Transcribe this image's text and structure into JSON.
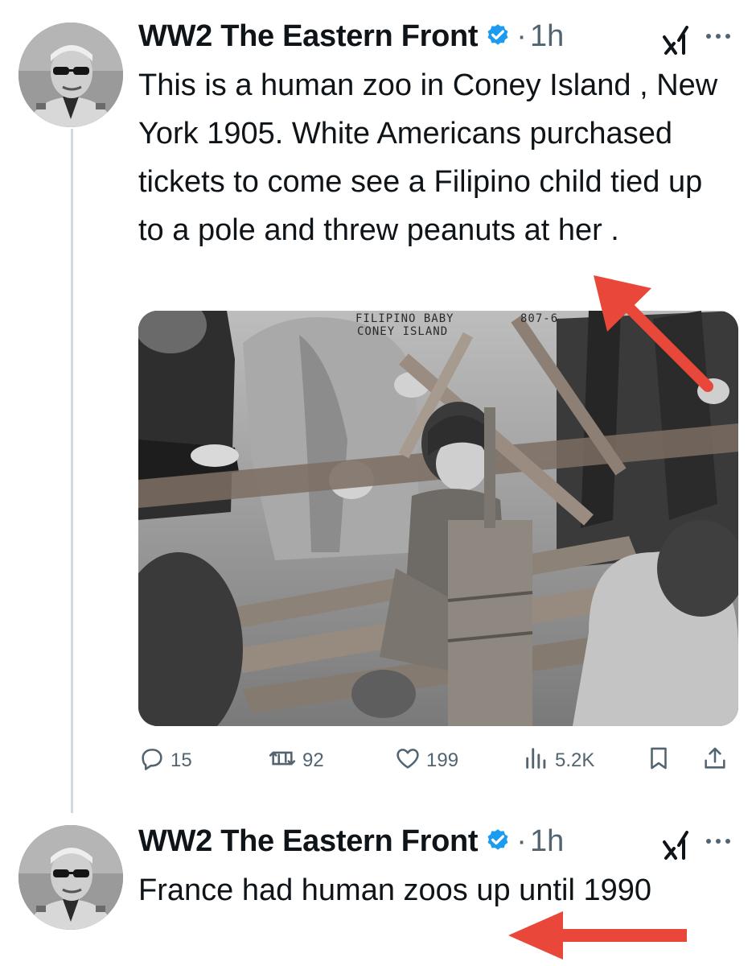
{
  "tweets": [
    {
      "author_name": "WW2 The Eastern Front",
      "verified": true,
      "separator": "·",
      "time": "1h",
      "text": "This is a human zoo in Coney Island , New York 1905. White Americans purchased tickets to come see a Filipino child tied up to a pole and threw peanuts at her .",
      "media": {
        "caption_line1": "FILIPINO  BABY",
        "caption_line2": "CONEY ISLAND",
        "caption_code": "807-6"
      },
      "stats": {
        "replies": "15",
        "reposts": "92",
        "likes": "199",
        "views": "5.2K"
      }
    },
    {
      "author_name": "WW2 The Eastern Front",
      "verified": true,
      "separator": "·",
      "time": "1h",
      "text": "France had human zoos up until 1990"
    }
  ],
  "colors": {
    "verified_blue": "#1d9bf0",
    "muted_text": "#536471",
    "thread_line": "#cfd9de",
    "annotation_arrow": "#e8473a"
  },
  "icons": [
    "verified-badge-icon",
    "grok-icon",
    "more-icon",
    "reply-icon",
    "repost-icon",
    "like-icon",
    "views-icon",
    "bookmark-icon",
    "share-icon"
  ]
}
